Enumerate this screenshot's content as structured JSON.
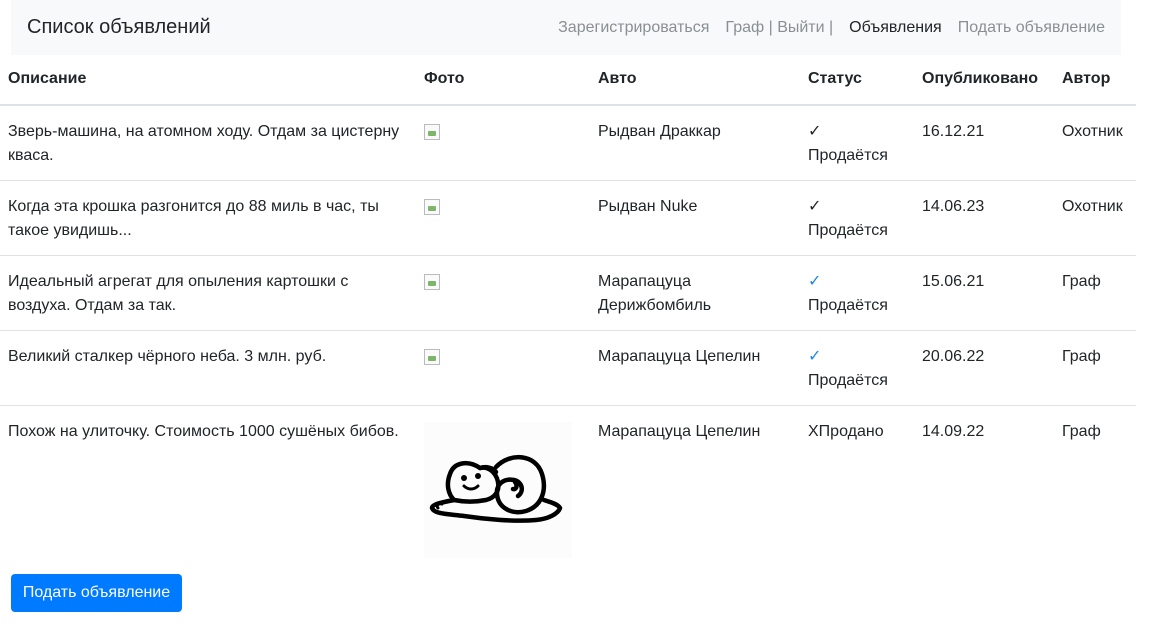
{
  "navbar": {
    "brand": "Список объявлений",
    "links": {
      "register": "Зарегистрироваться",
      "user": "Граф | Выйти |",
      "ads": "Объявления",
      "post": "Подать объявление"
    }
  },
  "table": {
    "headers": [
      "Описание",
      "Фото",
      "Авто",
      "Статус",
      "Опубликовано",
      "Автор"
    ],
    "rows": [
      {
        "description": "Зверь-машина, на атомном ходу. Отдам за цистерну кваса.",
        "auto": "Рыдван Драккар",
        "status_icon": "✓",
        "status_text": "Продаётся",
        "date": "16.12.21",
        "author": "Охотник"
      },
      {
        "description": "Когда эта крошка разгонится до 88 миль в час, ты такое увидишь...",
        "auto": "Рыдван Nuke",
        "status_icon": "✓",
        "status_text": "Продаётся",
        "date": "14.06.23",
        "author": "Охотник"
      },
      {
        "description": "Идеальный агрегат для опыления картошки с воздуха. Отдам за так.",
        "auto": "Марапацуца Дерижбомбиль",
        "status_icon": "✓",
        "status_text": "Продаётся",
        "date": "15.06.21",
        "author": "Граф"
      },
      {
        "description": "Великий сталкер чёрного неба. 3 млн. руб.",
        "auto": "Марапацуца Цепелин",
        "status_icon": "✓",
        "status_text": "Продаётся",
        "date": "20.06.22",
        "author": "Граф"
      },
      {
        "description": "Похож на улиточку. Стоимость 1000 сушёных бибов.",
        "auto": "Марапацуца Цепелин",
        "status_icon": "Х",
        "status_text": "Продано",
        "date": "14.09.22",
        "author": "Граф"
      }
    ]
  },
  "button": {
    "label": "Подать объявление"
  },
  "colors": {
    "primary": "#007bff",
    "check_blue": "#1e88e5",
    "navbar_bg": "#f8f9fa"
  }
}
